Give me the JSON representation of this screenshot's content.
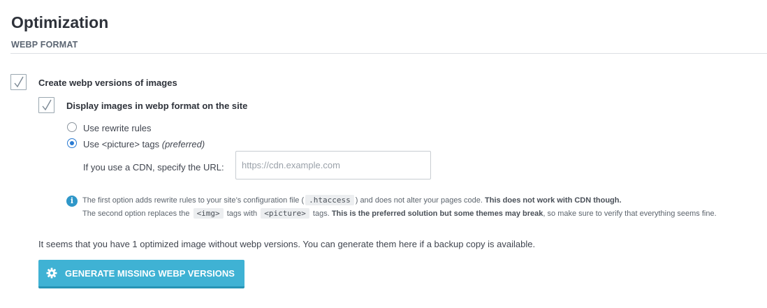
{
  "header": {
    "title": "Optimization",
    "section": "WEBP FORMAT"
  },
  "options": {
    "create_webp": {
      "label": "Create webp versions of images",
      "checked": true
    },
    "display_webp": {
      "label": "Display images in webp format on the site",
      "checked": true
    },
    "radios": [
      {
        "label": "Use rewrite rules",
        "checked": false
      },
      {
        "label": "Use <picture> tags",
        "suffix": "(preferred)",
        "checked": true
      }
    ],
    "cdn": {
      "label": "If you use a CDN, specify the URL:",
      "placeholder": "https://cdn.example.com",
      "value": ""
    }
  },
  "help": {
    "line1_a": "The first option adds rewrite rules to your site’s configuration file (",
    "line1_code": ".htaccess",
    "line1_b": ") and does not alter your pages code.",
    "line1_bold": "This does not work with CDN though.",
    "line2_a": "The second option replaces the",
    "line2_code1": "<img>",
    "line2_b": "tags with",
    "line2_code2": "<picture>",
    "line2_c": "tags.",
    "line2_bold": "This is the preferred solution but some themes may break",
    "line2_d": ", so make sure to verify that everything seems fine."
  },
  "notice": "It seems that you have 1 optimized image without webp versions. You can generate them here if a backup copy is available.",
  "button": {
    "label": "GENERATE MISSING WEBP VERSIONS",
    "icon": "gear-icon"
  },
  "colors": {
    "accent": "#3fb2d4",
    "radio_selected": "#2a7ad2",
    "info": "#2f97c9"
  }
}
